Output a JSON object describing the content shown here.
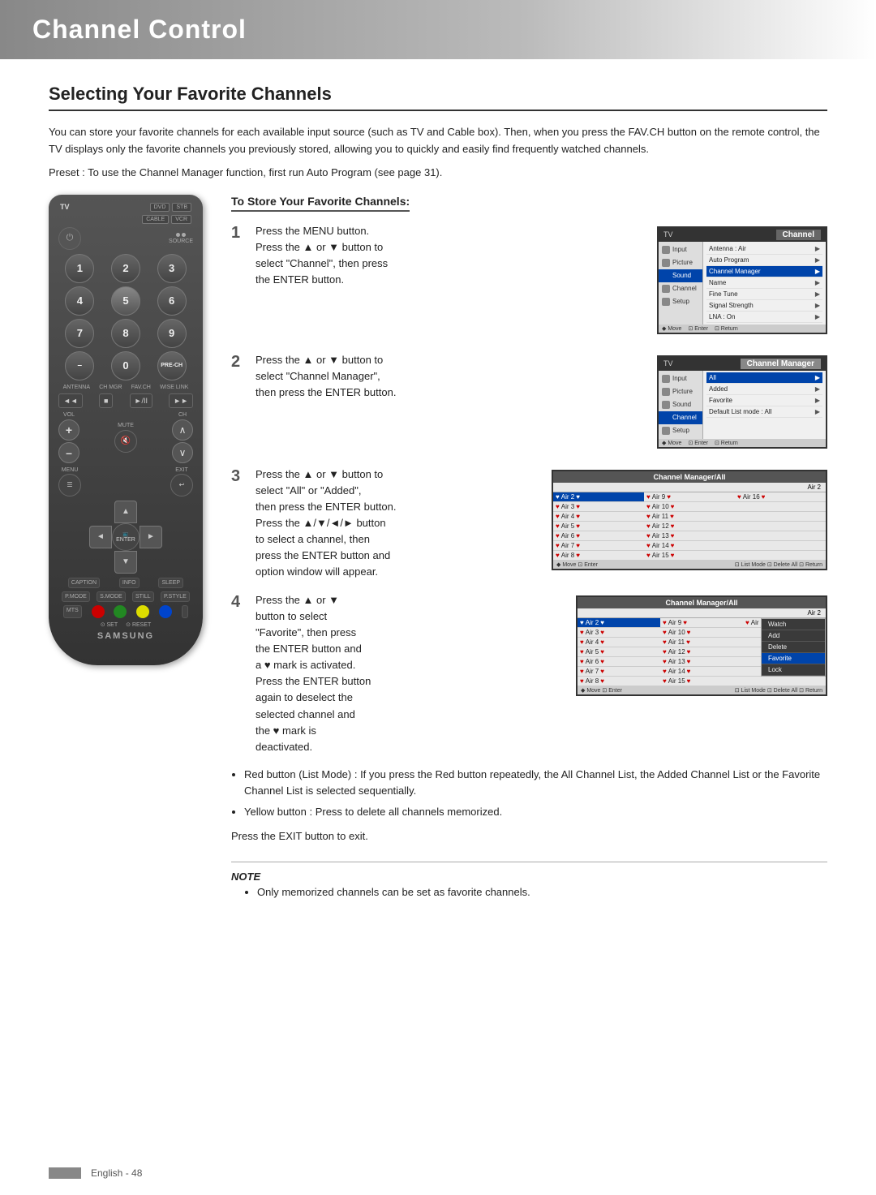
{
  "page": {
    "title": "Channel Control",
    "section": "Selecting Your Favorite Channels",
    "intro": "You can store your favorite channels for each available input source (such as TV and Cable box). Then, when you press the FAV.CH button on the remote control, the TV displays only the favorite channels you previously stored, allowing you to quickly and easily find frequently watched channels.",
    "preset": "Preset : To use the Channel Manager function, first run Auto Program (see page 31).",
    "footer_text": "English - 48"
  },
  "to_store": {
    "title": "To Store Your Favorite Channels:"
  },
  "steps": {
    "step1": {
      "number": "1",
      "text": "Press the MENU button.\nPress the ▲ or ▼ button to\nselect \"Channel\", then press\nthe ENTER button."
    },
    "step2": {
      "number": "2",
      "text": "Press the ▲ or ▼ button to\nselect \"Channel Manager\",\nthen press the ENTER button."
    },
    "step3": {
      "number": "3",
      "text": "Press the ▲ or ▼ button to\nselect \"All\" or \"Added\",\nthen press the ENTER button.\nPress the ▲/▼/◄/► button\nto select a channel, then\npress the ENTER button and\noption window will appear."
    },
    "step4": {
      "number": "4",
      "text": "Press the ▲ or ▼\nbutton to select\n\"Favorite\", then press\nthe ENTER button and\na ♥ mark is activated.\nPress the ENTER button\nagain to deselect the\nselected channel and\nthe ♥ mark is\ndeactivated."
    }
  },
  "bullets": {
    "red_button": "Red button\n(List Mode) : If you\npress the Red button\nrepeatedly, the All\nChannel List, the\nAdded Channel List or the Favorite Channel List is selected\nsequentially.",
    "yellow_button": "Yellow button : Press to delete all channels memorized."
  },
  "exit_text": "Press the EXIT button to exit.",
  "note": {
    "title": "NOTE",
    "text": "Only memorized channels can be set as favorite channels."
  },
  "tv_menu_screen1": {
    "header_left": "TV",
    "header_right": "Channel",
    "items": [
      {
        "label": "Input",
        "icon": "input"
      },
      {
        "label": "Antenna    : Air",
        "hasArrow": true
      },
      {
        "label": "Auto Program",
        "hasArrow": true
      },
      {
        "label": "Channel Manager",
        "hasArrow": true
      },
      {
        "label": "Name",
        "hasArrow": true
      },
      {
        "label": "Fine Tune",
        "hasArrow": true
      },
      {
        "label": "Signal Strength",
        "hasArrow": true
      },
      {
        "label": "LNA        : On",
        "hasArrow": true
      },
      {
        "label": "Setup",
        "icon": "setup"
      }
    ],
    "footer": "◆ Move   ⊡ Enter   ⊡ Return"
  },
  "tv_menu_screen2": {
    "header_left": "TV",
    "header_right": "Channel Manager",
    "items": [
      {
        "label": "Input"
      },
      {
        "label": "All",
        "hasArrow": true,
        "selected": true
      },
      {
        "label": "Added",
        "hasArrow": true
      },
      {
        "label": "Favorite",
        "hasArrow": true
      },
      {
        "label": "Default List mode  : All",
        "hasArrow": true
      },
      {
        "label": "Picture"
      },
      {
        "label": "Sound"
      },
      {
        "label": "Channel"
      },
      {
        "label": "Setup"
      }
    ],
    "footer": "◆ Move   ⊡ Enter   ⊡ Return"
  },
  "ch_mgr_all_screen": {
    "header": "Channel Manager/All",
    "subheader": "Air 2",
    "channels_col1": [
      "Air 2",
      "Air 3",
      "Air 4",
      "Air 5",
      "Air 6",
      "Air 7",
      "Air 8"
    ],
    "channels_col2": [
      "Air 9",
      "Air 10",
      "Air 11",
      "Air 12",
      "Air 13",
      "Air 14",
      "Air 15"
    ],
    "channels_col3": [
      "Air 16",
      "",
      "",
      "",
      "",
      "",
      ""
    ],
    "footer_left": "◆ Move   ⊡ Enter",
    "footer_right": "⊡ Delete All   ⊡ Return"
  },
  "option_screen": {
    "header": "Channel Manager/All",
    "subheader": "Air 2",
    "options": [
      "Watch",
      "Add",
      "Delete",
      "Favorite",
      "Lock"
    ],
    "footer_left": "◆ Move   ⊡ Enter",
    "footer_right": "⊡ Delete All   ⊡ Return"
  },
  "remote": {
    "samsung_label": "SAMSUNG",
    "buttons": {
      "tv": "TV",
      "dvd": "DVD",
      "stb": "STB",
      "cable": "CABLE",
      "vcr": "VCR",
      "power": "⏻",
      "source": "SOURCE",
      "numbers": [
        "1",
        "2",
        "3",
        "4",
        "5",
        "6",
        "7",
        "8",
        "9",
        "-",
        "0",
        "PRE-CH"
      ],
      "antenna": "ANTENNA",
      "ch_mgr": "CH MGR",
      "fav": "FAV.CH",
      "wise_link": "WISE LINK",
      "rew": "◄◄",
      "stop": "■",
      "play_pause": "►/II",
      "ff": "►►",
      "vol_label": "VOL",
      "ch_label": "CH",
      "mute": "MUTE",
      "menu": "MENU",
      "exit": "EXIT",
      "enter": "ENTER",
      "caption": "CAPTION",
      "info": "INFO",
      "sleep": "SLEEP",
      "p_mode": "P.MODE",
      "s_mode": "S.MODE",
      "still": "STILL",
      "p_style": "P.STYLE",
      "mts": "MTS",
      "set": "SET",
      "reset": "RESET"
    }
  }
}
